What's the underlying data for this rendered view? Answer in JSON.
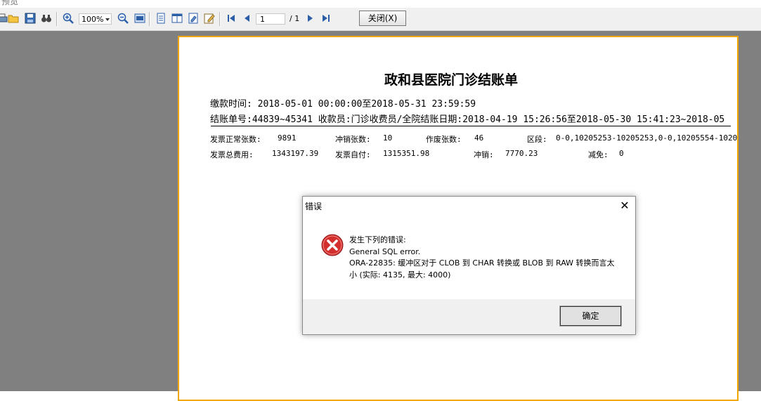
{
  "window": {
    "title": "预览"
  },
  "toolbar": {
    "zoom": "100%",
    "page_current": "1",
    "page_total": "/ 1",
    "close_label": "关闭(X)",
    "icons": [
      "print-icon",
      "open-icon",
      "save-icon",
      "find-icon",
      "zoom-in-icon",
      "zoom-out-icon",
      "page-width-icon",
      "one-page-icon",
      "multi-page-icon",
      "page-setup-icon",
      "edit-icon",
      "first-page-icon",
      "prev-page-icon",
      "next-page-icon",
      "last-page-icon"
    ]
  },
  "report": {
    "title": "政和县医院门诊结账单",
    "line1": "缴款时间: 2018-05-01 00:00:00至2018-05-31 23:59:59",
    "line2": "结账单号:44839~45341  收款员:门诊收费员/全院结账日期:2018-04-19 15:26:56至2018-05-30 15:41:23~2018-05",
    "row1": [
      {
        "label": "发票正常张数:",
        "value": "9891"
      },
      {
        "label": "冲销张数:",
        "value": "10"
      },
      {
        "label": "作废张数:",
        "value": "46"
      },
      {
        "label": "区段:",
        "value": "0-0,10205253-10205253,0-0,10205554-1020"
      }
    ],
    "row2": [
      {
        "label": "发票总费用:",
        "value": "1343197.39"
      },
      {
        "label": "发票自付:",
        "value": "1315351.98"
      },
      {
        "label": "冲销:",
        "value": "7770.23"
      },
      {
        "label": "减免:",
        "value": "0"
      }
    ]
  },
  "dialog": {
    "title": "错误",
    "close_glyph": "✕",
    "lines": [
      "发生下列的错误:",
      "General SQL error.",
      "ORA-22835: 缓冲区对于 CLOB 到 CHAR 转换或 BLOB 到 RAW 转换而言太",
      "小 (实际: 4135, 最大: 4000)"
    ],
    "ok_label": "确定"
  },
  "colors": {
    "viewer_bg": "#808080",
    "page_border": "#f0a800",
    "error_red": "#d32f2f"
  }
}
